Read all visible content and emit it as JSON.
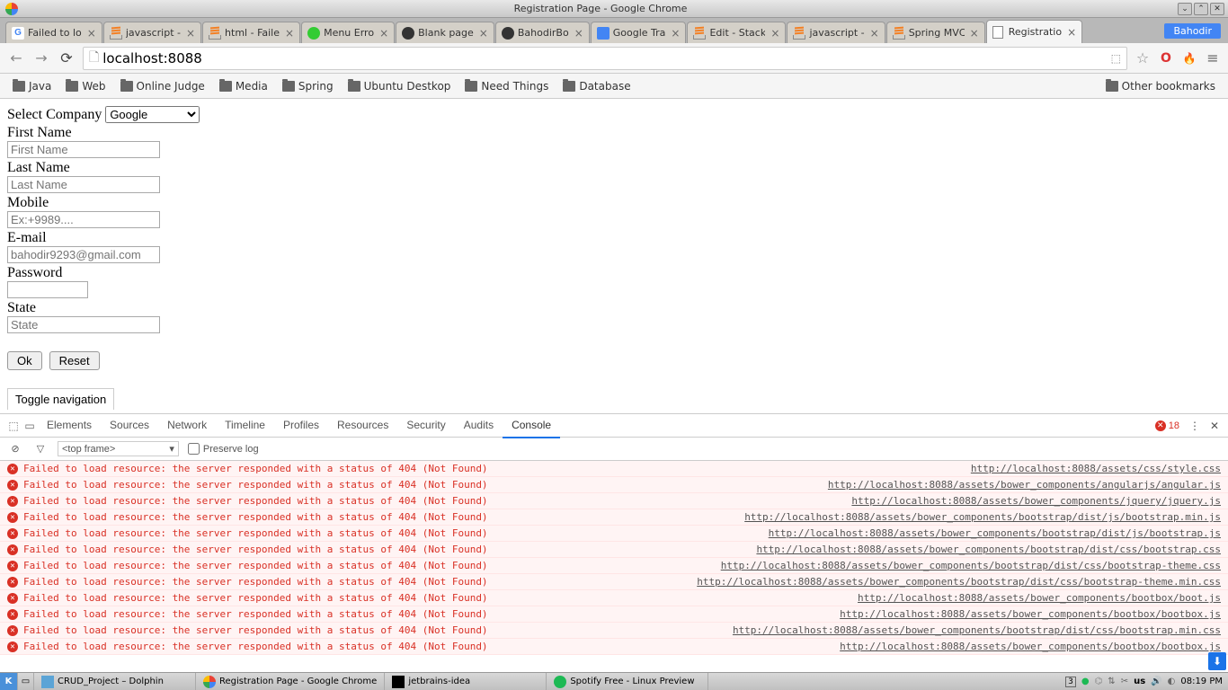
{
  "window": {
    "title": "Registration Page - Google Chrome"
  },
  "tabs": [
    {
      "title": "Failed to lo",
      "icon": "google"
    },
    {
      "title": "javascript -",
      "icon": "stackoverflow"
    },
    {
      "title": "html - Faile",
      "icon": "stackoverflow"
    },
    {
      "title": "Menu Erro",
      "icon": "green"
    },
    {
      "title": "Blank page",
      "icon": "github"
    },
    {
      "title": "BahodirBo",
      "icon": "github"
    },
    {
      "title": "Google Tra",
      "icon": "google-translate"
    },
    {
      "title": "Edit - Stack",
      "icon": "stackoverflow"
    },
    {
      "title": "javascript -",
      "icon": "stackoverflow"
    },
    {
      "title": "Spring MVC",
      "icon": "stackoverflow"
    },
    {
      "title": "Registratio",
      "icon": "doc",
      "active": true
    }
  ],
  "user_badge": "Bahodir",
  "url": "localhost:8088",
  "bookmarks": [
    "Java",
    "Web",
    "Online Judge",
    "Media",
    "Spring",
    "Ubuntu Destkop",
    "Need Things",
    "Database"
  ],
  "other_bookmarks": "Other bookmarks",
  "form": {
    "select_label": "Select Company",
    "select_value": "Google",
    "first_name_label": "First Name",
    "first_name_placeholder": "First Name",
    "last_name_label": "Last Name",
    "last_name_placeholder": "Last Name",
    "mobile_label": "Mobile",
    "mobile_placeholder": "Ex:+9989....",
    "email_label": "E-mail",
    "email_placeholder": "bahodir9293@gmail.com",
    "password_label": "Password",
    "state_label": "State",
    "state_placeholder": "State",
    "ok_btn": "Ok",
    "reset_btn": "Reset",
    "toggle_nav": "Toggle navigation"
  },
  "devtools": {
    "tabs": [
      "Elements",
      "Sources",
      "Network",
      "Timeline",
      "Profiles",
      "Resources",
      "Security",
      "Audits",
      "Console"
    ],
    "active_tab": "Console",
    "error_count": "18",
    "frame_selector": "<top frame>",
    "preserve_log": "Preserve log",
    "error_msg": "Failed to load resource: the server responded with a status of 404 (Not Found)",
    "errors": [
      "http://localhost:8088/assets/css/style.css",
      "http://localhost:8088/assets/bower_components/angularjs/angular.js",
      "http://localhost:8088/assets/bower_components/jquery/jquery.js",
      "http://localhost:8088/assets/bower_components/bootstrap/dist/js/bootstrap.min.js",
      "http://localhost:8088/assets/bower_components/bootstrap/dist/js/bootstrap.js",
      "http://localhost:8088/assets/bower_components/bootstrap/dist/css/bootstrap.css",
      "http://localhost:8088/assets/bower_components/bootstrap/dist/css/bootstrap-theme.css",
      "http://localhost:8088/assets/bower_components/bootstrap/dist/css/bootstrap-theme.min.css",
      "http://localhost:8088/assets/bower_components/bootbox/boot.js",
      "http://localhost:8088/assets/bower_components/bootbox/bootbox.js",
      "http://localhost:8088/assets/bower_components/bootstrap/dist/css/bootstrap.min.css",
      "http://localhost:8088/assets/bower_components/bootbox/bootbox.js"
    ]
  },
  "taskbar": {
    "items": [
      {
        "label": "CRUD_Project – Dolphin",
        "icon": "dolphin"
      },
      {
        "label": "Registration Page - Google Chrome",
        "icon": "chrome"
      },
      {
        "label": "jetbrains-idea",
        "icon": "idea"
      },
      {
        "label": "Spotify Free - Linux Preview",
        "icon": "spotify"
      }
    ],
    "battery": "3",
    "layout": "us",
    "time": "08:19 PM"
  }
}
